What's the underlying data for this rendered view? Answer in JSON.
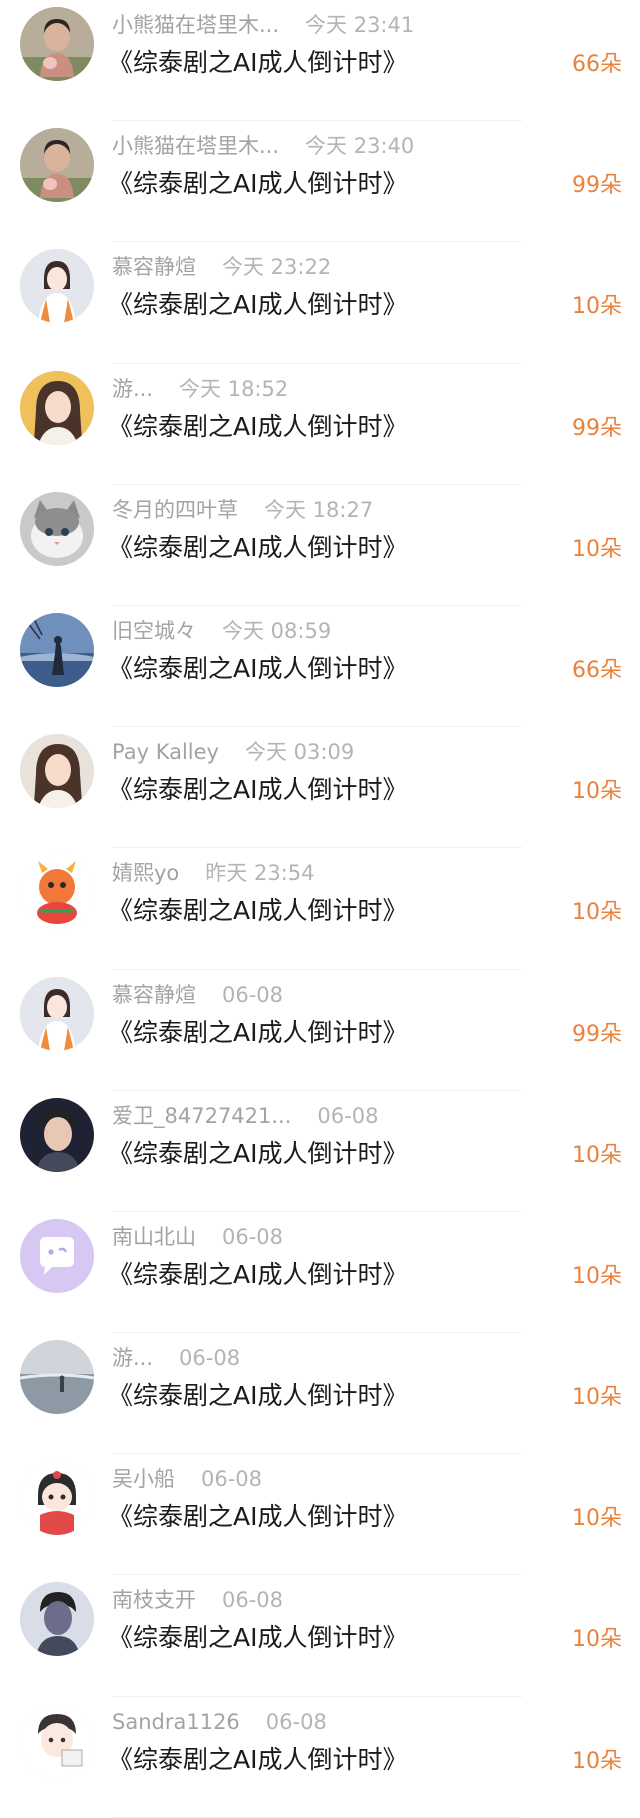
{
  "colors": {
    "name": "#a3a3a3",
    "title": "#1b1b1b",
    "flowers": "#e9823c"
  },
  "items": [
    {
      "name": "小熊猫在塔里木...",
      "time": "今天 23:41",
      "title": "《综泰剧之AI成人倒计时》",
      "flowers": "66朵",
      "avatar": {
        "icon": "child-photo-icon",
        "bg": "#b7ad9a",
        "fg": "#d9b39b"
      }
    },
    {
      "name": "小熊猫在塔里木...",
      "time": "今天 23:40",
      "title": "《综泰剧之AI成人倒计时》",
      "flowers": "99朵",
      "avatar": {
        "icon": "child-photo-icon",
        "bg": "#b7ad9a",
        "fg": "#d9b39b"
      }
    },
    {
      "name": "慕容静煊",
      "time": "今天 23:22",
      "title": "《综泰剧之AI成人倒计时》",
      "flowers": "10朵",
      "avatar": {
        "icon": "girl-snow-photo-icon",
        "bg": "#e3e6ec",
        "fg": "#f08c3a"
      }
    },
    {
      "name": "游...",
      "time": "今天 18:52",
      "title": "《综泰剧之AI成人倒计时》",
      "flowers": "99朵",
      "avatar": {
        "icon": "woman-portrait-icon",
        "bg": "#f0c05a",
        "fg": "#f7dccb"
      }
    },
    {
      "name": "冬月的四叶草",
      "time": "今天 18:27",
      "title": "《综泰剧之AI成人倒计时》",
      "flowers": "10朵",
      "avatar": {
        "icon": "cat-icon",
        "bg": "#c9c9c9",
        "fg": "#f2f2f2"
      }
    },
    {
      "name": "旧空城々",
      "time": "今天 08:59",
      "title": "《综泰剧之AI成人倒计时》",
      "flowers": "66朵",
      "avatar": {
        "icon": "lake-silhouette-icon",
        "bg": "#6f8fbd",
        "fg": "#1f2a3a"
      }
    },
    {
      "name": "Pay Kalley",
      "time": "今天 03:09",
      "title": "《综泰剧之AI成人倒计时》",
      "flowers": "10朵",
      "avatar": {
        "icon": "woman-portrait-icon",
        "bg": "#e8e2da",
        "fg": "#3a2f29"
      }
    },
    {
      "name": "婧熙yo",
      "time": "昨天 23:54",
      "title": "《综泰剧之AI成人倒计时》",
      "flowers": "10朵",
      "avatar": {
        "icon": "dragon-cartoon-icon",
        "bg": "#ffffff",
        "fg": "#f2783a"
      }
    },
    {
      "name": "慕容静煊",
      "time": "06-08",
      "title": "《综泰剧之AI成人倒计时》",
      "flowers": "99朵",
      "avatar": {
        "icon": "girl-snow-photo-icon",
        "bg": "#e3e6ec",
        "fg": "#f08c3a"
      }
    },
    {
      "name": "爱卫_84727421...",
      "time": "06-08",
      "title": "《综泰剧之AI成人倒计时》",
      "flowers": "10朵",
      "avatar": {
        "icon": "man-portrait-icon",
        "bg": "#1e2233",
        "fg": "#e8c7b5"
      }
    },
    {
      "name": "南山北山",
      "time": "06-08",
      "title": "《综泰剧之AI成人倒计时》",
      "flowers": "10朵",
      "avatar": {
        "icon": "chat-bubble-icon",
        "bg": "#d7c8f3",
        "fg": "#ffffff"
      }
    },
    {
      "name": "游...",
      "time": "06-08",
      "title": "《综泰剧之AI成人倒计时》",
      "flowers": "10朵",
      "avatar": {
        "icon": "sea-figure-icon",
        "bg": "#cfd5da",
        "fg": "#3a4048"
      }
    },
    {
      "name": "吴小船",
      "time": "06-08",
      "title": "《综泰剧之AI成人倒计时》",
      "flowers": "10朵",
      "avatar": {
        "icon": "cartoon-girl-icon",
        "bg": "#ffffff",
        "fg": "#e24a4a"
      }
    },
    {
      "name": "南枝支开",
      "time": "06-08",
      "title": "《综泰剧之AI成人倒计时》",
      "flowers": "10朵",
      "avatar": {
        "icon": "man-portrait-icon",
        "bg": "#d8dde8",
        "fg": "#6b6d8a"
      }
    },
    {
      "name": "Sandra1126",
      "time": "06-08",
      "title": "《综泰剧之AI成人倒计时》",
      "flowers": "10朵",
      "avatar": {
        "icon": "cartoon-boy-icon",
        "bg": "#ffffff",
        "fg": "#3a3434"
      }
    }
  ]
}
